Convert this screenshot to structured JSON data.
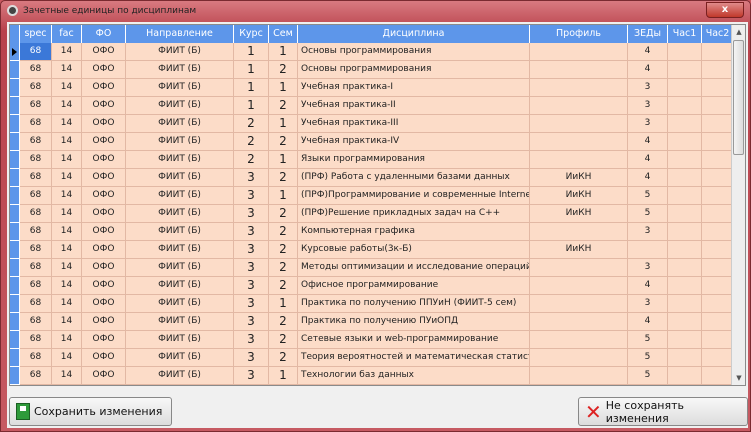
{
  "window": {
    "title": "Зачетные единицы по дисциплинам",
    "close": "x"
  },
  "columns": [
    "spec",
    "fac",
    "ФО",
    "Направление",
    "Курс",
    "Сем",
    "Дисциплина",
    "Профиль",
    "ЗЕДы",
    "Час1",
    "Час2"
  ],
  "rows": [
    [
      "68",
      "14",
      "ОФО",
      "ФИИТ (Б)",
      "1",
      "1",
      "Основы программирования",
      "",
      "4",
      "",
      ""
    ],
    [
      "68",
      "14",
      "ОФО",
      "ФИИТ (Б)",
      "1",
      "2",
      "Основы программирования",
      "",
      "4",
      "",
      ""
    ],
    [
      "68",
      "14",
      "ОФО",
      "ФИИТ (Б)",
      "1",
      "1",
      "Учебная практика-I",
      "",
      "3",
      "",
      ""
    ],
    [
      "68",
      "14",
      "ОФО",
      "ФИИТ (Б)",
      "1",
      "2",
      "Учебная практика-II",
      "",
      "3",
      "",
      ""
    ],
    [
      "68",
      "14",
      "ОФО",
      "ФИИТ (Б)",
      "2",
      "1",
      "Учебная практика-III",
      "",
      "3",
      "",
      ""
    ],
    [
      "68",
      "14",
      "ОФО",
      "ФИИТ (Б)",
      "2",
      "2",
      "Учебная практика-IV",
      "",
      "4",
      "",
      ""
    ],
    [
      "68",
      "14",
      "ОФО",
      "ФИИТ (Б)",
      "2",
      "1",
      "Языки программирования",
      "",
      "4",
      "",
      ""
    ],
    [
      "68",
      "14",
      "ОФО",
      "ФИИТ (Б)",
      "3",
      "2",
      "(ПРФ) Работа с удаленными базами данных",
      "ИиКН",
      "4",
      "",
      ""
    ],
    [
      "68",
      "14",
      "ОФО",
      "ФИИТ (Б)",
      "3",
      "1",
      "(ПРФ)Программирование и современные Internet-т",
      "ИиКН",
      "5",
      "",
      ""
    ],
    [
      "68",
      "14",
      "ОФО",
      "ФИИТ (Б)",
      "3",
      "2",
      "(ПРФ)Решение прикладных задач на С++",
      "ИиКН",
      "5",
      "",
      ""
    ],
    [
      "68",
      "14",
      "ОФО",
      "ФИИТ (Б)",
      "3",
      "2",
      "Компьютерная графика",
      "",
      "3",
      "",
      ""
    ],
    [
      "68",
      "14",
      "ОФО",
      "ФИИТ (Б)",
      "3",
      "2",
      "Курсовые работы(3к-Б)",
      "ИиКН",
      "",
      "",
      ""
    ],
    [
      "68",
      "14",
      "ОФО",
      "ФИИТ (Б)",
      "3",
      "2",
      "Методы оптимизации и исследование операций",
      "",
      "3",
      "",
      ""
    ],
    [
      "68",
      "14",
      "ОФО",
      "ФИИТ (Б)",
      "3",
      "2",
      "Офисное программирование",
      "",
      "4",
      "",
      ""
    ],
    [
      "68",
      "14",
      "ОФО",
      "ФИИТ (Б)",
      "3",
      "1",
      "Практика по получению ППУиН (ФИИТ-5 сем)",
      "",
      "3",
      "",
      ""
    ],
    [
      "68",
      "14",
      "ОФО",
      "ФИИТ (Б)",
      "3",
      "2",
      "Практика по получению ПУиОПД",
      "",
      "4",
      "",
      ""
    ],
    [
      "68",
      "14",
      "ОФО",
      "ФИИТ (Б)",
      "3",
      "2",
      "Сетевые языки и web-программирование",
      "",
      "5",
      "",
      ""
    ],
    [
      "68",
      "14",
      "ОФО",
      "ФИИТ (Б)",
      "3",
      "2",
      "Теория вероятностей и математическая статистика",
      "",
      "5",
      "",
      ""
    ],
    [
      "68",
      "14",
      "ОФО",
      "ФИИТ (Б)",
      "3",
      "1",
      "Технологии баз данных",
      "",
      "5",
      "",
      ""
    ]
  ],
  "buttons": {
    "save": "Сохранить изменения",
    "cancel": "Не сохранять изменения"
  }
}
